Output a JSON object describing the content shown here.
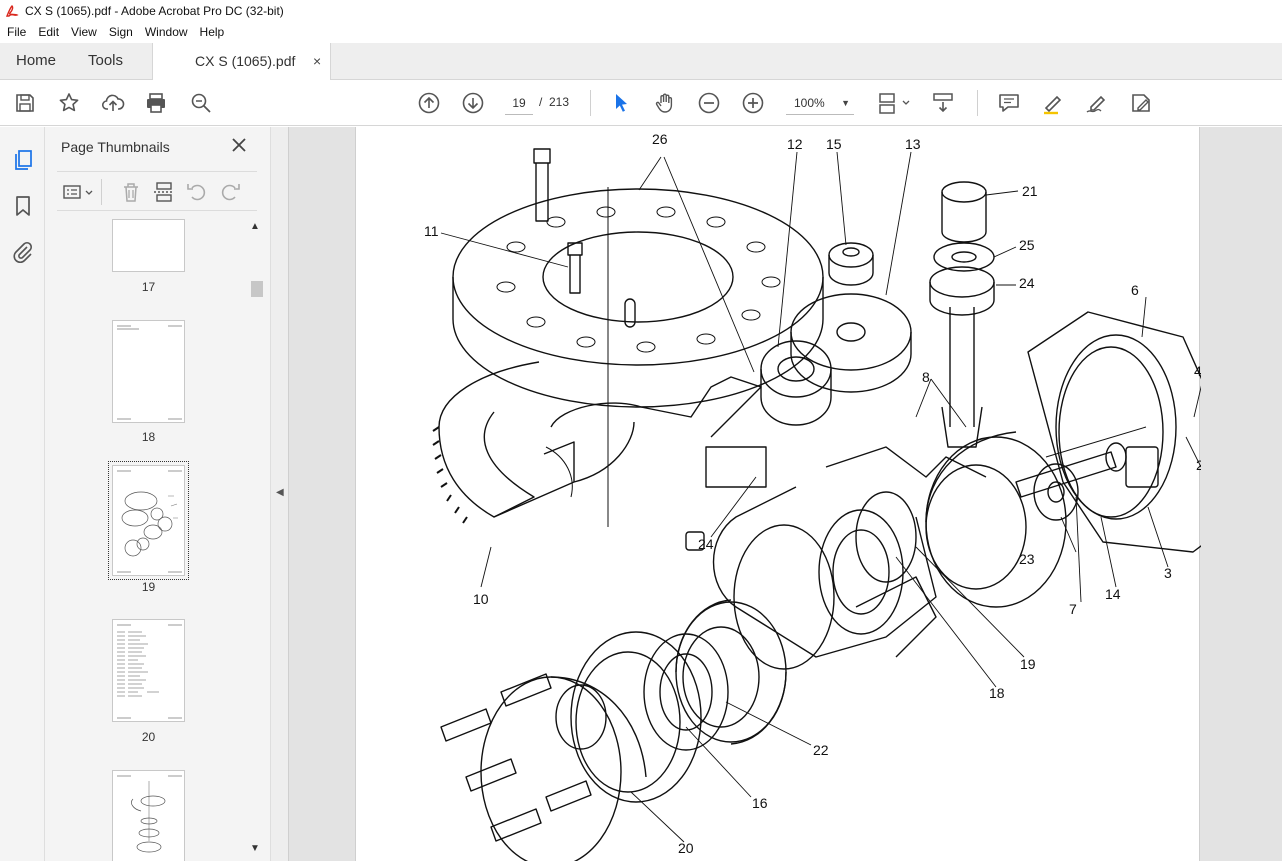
{
  "window": {
    "title": "CX S (1065).pdf - Adobe Acrobat Pro DC (32-bit)"
  },
  "menu": [
    "File",
    "Edit",
    "View",
    "Sign",
    "Window",
    "Help"
  ],
  "tabs": {
    "home": "Home",
    "tools": "Tools",
    "document": "CX S (1065).pdf",
    "close_glyph": "×"
  },
  "toolbar": {
    "current_page": "19",
    "page_separator": "/",
    "total_pages": "213",
    "zoom": "100%",
    "zoom_caret": "▼"
  },
  "panel": {
    "title": "Page Thumbnails",
    "thumbnails": [
      {
        "page": "17"
      },
      {
        "page": "18"
      },
      {
        "page": "19",
        "selected": true
      },
      {
        "page": "20"
      },
      {
        "page": ""
      }
    ]
  },
  "drawing": {
    "callouts": [
      "26",
      "12",
      "15",
      "13",
      "21",
      "11",
      "25",
      "24",
      "6",
      "4",
      "8",
      "2",
      "23",
      "24",
      "10",
      "7",
      "14",
      "3",
      "19",
      "18",
      "22",
      "16",
      "20"
    ]
  },
  "colors": {
    "accent": "#1a73e8",
    "pdf_red": "#d9261c",
    "chrome_bg": "#eeeeee",
    "doc_bg": "#e3e3e3"
  },
  "icons": {
    "rail": [
      "page-thumbnails-icon",
      "bookmark-icon",
      "attachment-icon"
    ],
    "toolbar_left": [
      "save-icon",
      "bookmark-star-icon",
      "upload-icon",
      "print-icon",
      "zoom-search-icon"
    ]
  }
}
